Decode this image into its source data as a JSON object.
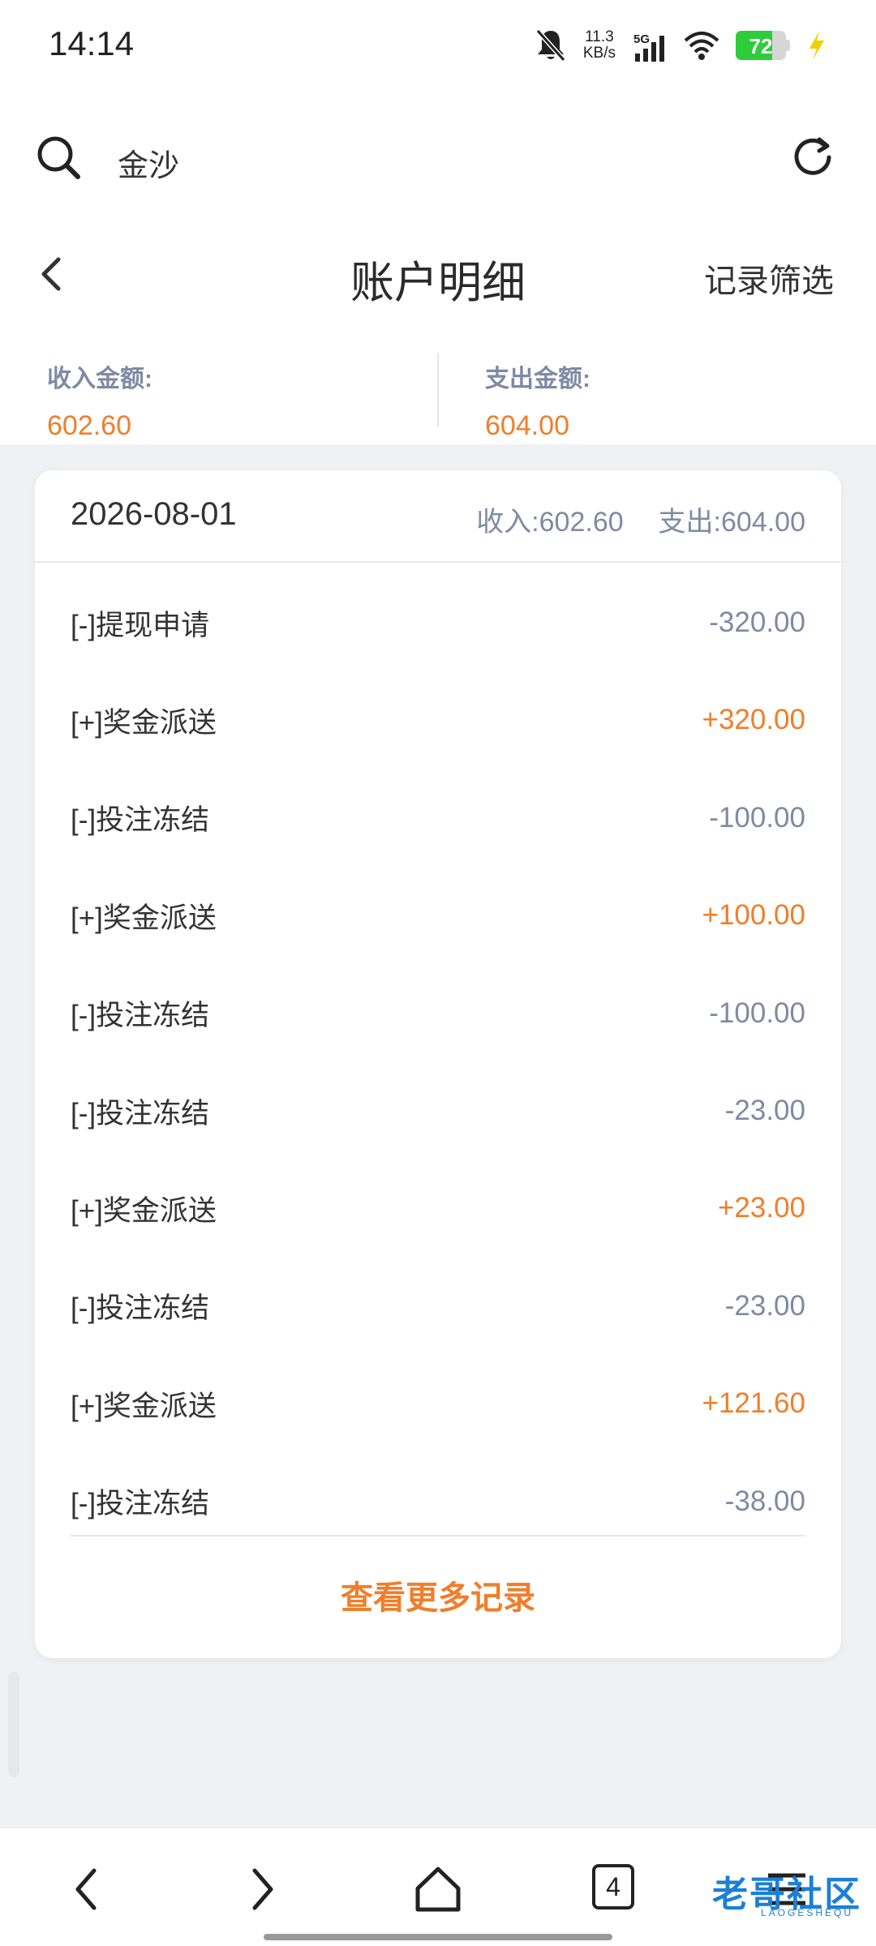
{
  "status_bar": {
    "time": "14:14",
    "net_speed_value": "11.3",
    "net_speed_unit": "KB/s",
    "signal_label": "5G",
    "battery": "72",
    "battery_level": 0.72
  },
  "search": {
    "query": "金沙"
  },
  "header": {
    "title": "账户明细",
    "filter": "记录筛选"
  },
  "summary": {
    "income_label": "收入金额:",
    "income_value": "602.60",
    "expense_label": "支出金额:",
    "expense_value": "604.00"
  },
  "card": {
    "date": "2026-08-01",
    "income_prefix": "收入:",
    "income_value": "602.60",
    "expense_prefix": "支出:",
    "expense_value": "604.00",
    "rows": [
      {
        "label": "[-]提现申请",
        "amount": "-320.00",
        "type": "negative"
      },
      {
        "label": "[+]奖金派送",
        "amount": "+320.00",
        "type": "positive"
      },
      {
        "label": "[-]投注冻结",
        "amount": "-100.00",
        "type": "negative"
      },
      {
        "label": "[+]奖金派送",
        "amount": "+100.00",
        "type": "positive"
      },
      {
        "label": "[-]投注冻结",
        "amount": "-100.00",
        "type": "negative"
      },
      {
        "label": "[-]投注冻结",
        "amount": "-23.00",
        "type": "negative"
      },
      {
        "label": "[+]奖金派送",
        "amount": "+23.00",
        "type": "positive"
      },
      {
        "label": "[-]投注冻结",
        "amount": "-23.00",
        "type": "negative"
      },
      {
        "label": "[+]奖金派送",
        "amount": "+121.60",
        "type": "positive"
      },
      {
        "label": "[-]投注冻结",
        "amount": "-38.00",
        "type": "negative"
      }
    ],
    "more_label": "查看更多记录"
  },
  "nav": {
    "tab_count": "4"
  },
  "watermark": {
    "text": "老哥社区",
    "sub": "LAOGESHEQU"
  },
  "colors": {
    "accent": "#f07e2a",
    "muted": "#7f8aa3",
    "background": "#f0f1f5"
  }
}
